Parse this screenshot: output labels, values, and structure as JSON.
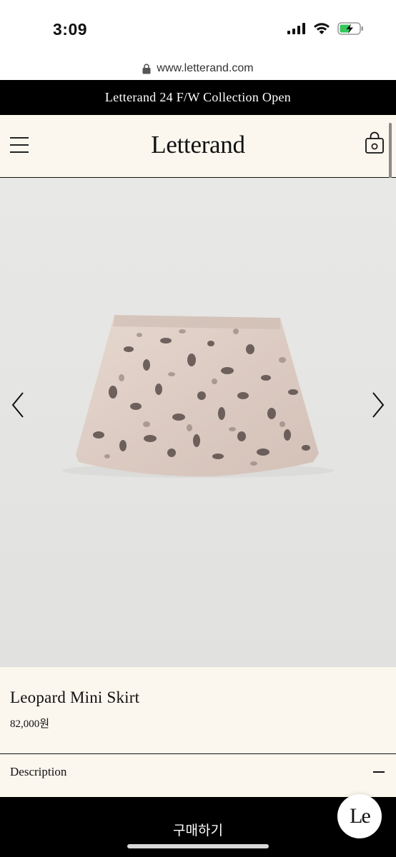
{
  "status_bar": {
    "time": "3:09",
    "icons": [
      "cellular-signal-icon",
      "wifi-icon",
      "battery-charging-icon"
    ],
    "battery_color": "#34c759"
  },
  "browser": {
    "url": "www.letterand.com",
    "icon": "lock-icon"
  },
  "announcement": {
    "text": "Letterand 24 F/W Collection Open"
  },
  "header": {
    "logo": "Letterand",
    "menu_icon": "hamburger-menu-icon",
    "cart_icon": "shopping-bag-icon"
  },
  "product": {
    "image_description_icon": "leopard-mini-skirt-image",
    "name": "Leopard Mini Skirt",
    "price": "82,000원"
  },
  "description": {
    "label": "Description",
    "toggle_icon": "minus-icon"
  },
  "buy": {
    "label": "구매하기"
  },
  "chat": {
    "label": "Le"
  },
  "colors": {
    "header_bg": "#fbf6ee",
    "announce_bg": "#000000",
    "image_bg": "#e5e5e3"
  }
}
